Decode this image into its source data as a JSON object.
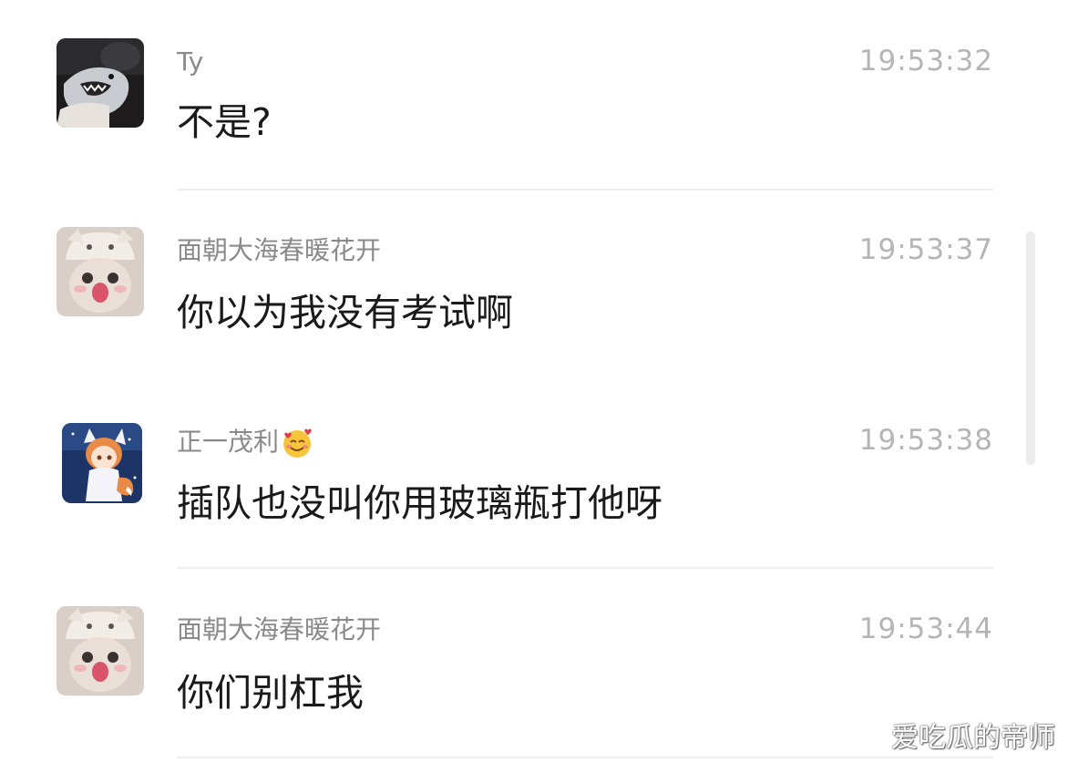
{
  "messages": [
    {
      "sender": "Ty",
      "time": "19:53:32",
      "text": "不是?",
      "avatar_icon": "shark-plush-avatar"
    },
    {
      "sender": "面朝大海春暖花开",
      "time": "19:53:37",
      "text": "你以为我没有考试啊",
      "avatar_icon": "cat-hat-avatar"
    },
    {
      "sender": "正一茂利",
      "sender_emoji": "smiling-face-with-hearts-emoji",
      "time": "19:53:38",
      "text": "插队也没叫你用玻璃瓶打他呀",
      "avatar_icon": "anime-fox-girl-avatar"
    },
    {
      "sender": "面朝大海春暖花开",
      "time": "19:53:44",
      "text": "你们别杠我",
      "avatar_icon": "cat-hat-avatar"
    }
  ],
  "watermark": "爱吃瓜的帝师",
  "colors": {
    "background": "#ffffff",
    "name": "#8a8a8a",
    "time": "#b5b5b5",
    "text": "#1a1a1a",
    "divider": "#efefef"
  }
}
